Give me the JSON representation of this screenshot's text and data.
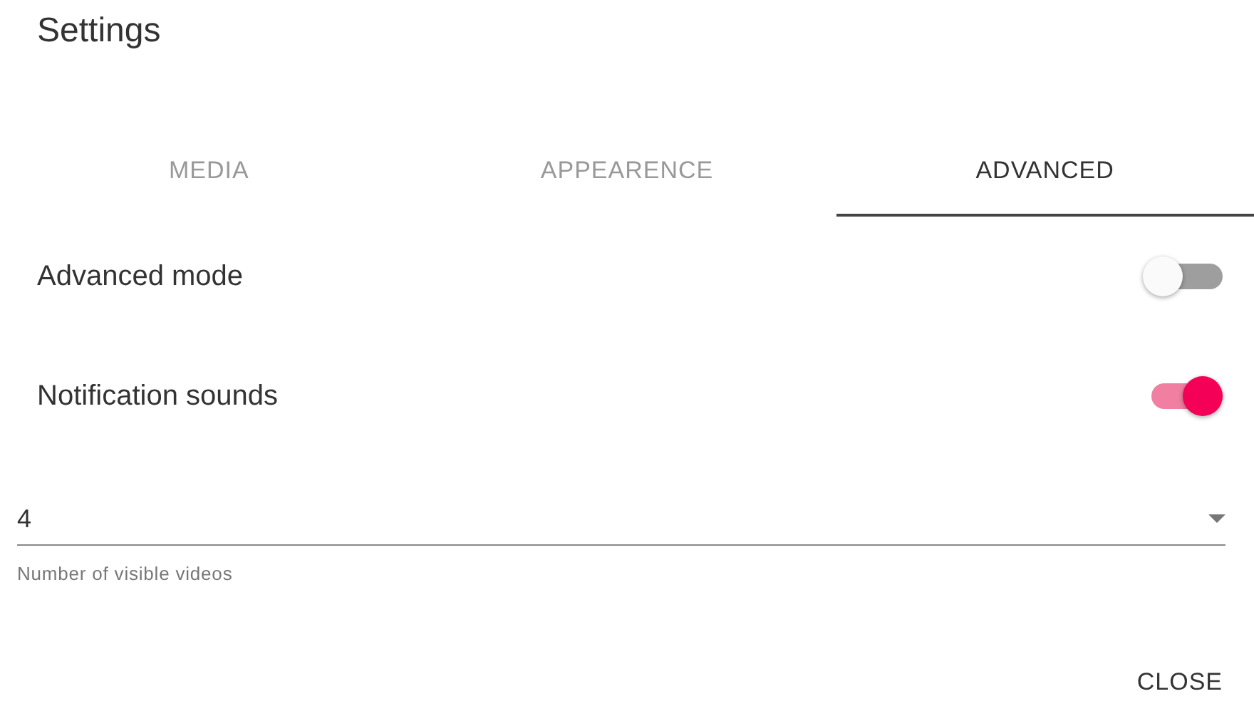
{
  "dialog": {
    "title": "Settings"
  },
  "tabs": [
    {
      "label": "MEDIA",
      "selected": false
    },
    {
      "label": "APPEARENCE",
      "selected": false
    },
    {
      "label": "ADVANCED",
      "selected": true
    }
  ],
  "toggles": [
    {
      "label": "Advanced mode",
      "on": false
    },
    {
      "label": "Notification sounds",
      "on": true
    }
  ],
  "select": {
    "value": "4",
    "helper": "Number of visible videos"
  },
  "buttons": [
    "CLOSE"
  ]
}
